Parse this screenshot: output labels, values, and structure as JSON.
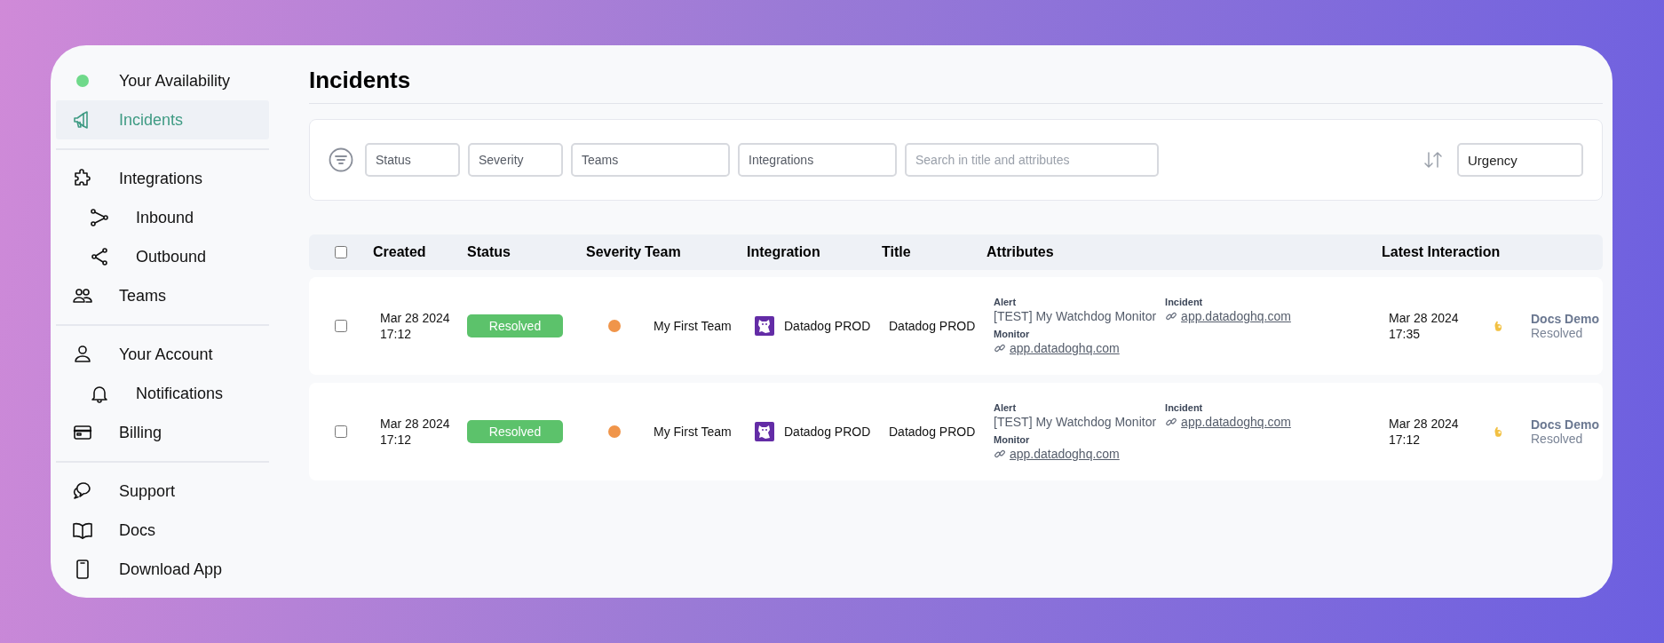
{
  "sidebar": {
    "groups": [
      [
        {
          "label": "Your Availability",
          "kind": "status",
          "color": "#6fd98a",
          "selected": false
        },
        {
          "label": "Incidents",
          "kind": "link",
          "selected": true
        }
      ],
      [
        {
          "label": "Integrations",
          "kind": "link",
          "selected": false,
          "children": [
            {
              "label": "Inbound",
              "kind": "link",
              "selected": false
            },
            {
              "label": "Outbound",
              "kind": "link",
              "selected": false
            }
          ]
        },
        {
          "label": "Teams",
          "kind": "link",
          "selected": false
        }
      ],
      [
        {
          "label": "Your Account",
          "kind": "link",
          "selected": false,
          "children": [
            {
              "label": "Notifications",
              "kind": "link",
              "selected": false
            }
          ]
        },
        {
          "label": "Billing",
          "kind": "link",
          "selected": false
        }
      ],
      [
        {
          "label": "Support",
          "kind": "link",
          "selected": false
        },
        {
          "label": "Docs",
          "kind": "link",
          "selected": false
        },
        {
          "label": "Download App",
          "kind": "link",
          "selected": false
        }
      ]
    ]
  },
  "page": {
    "title": "Incidents"
  },
  "filters": [
    {
      "kind": "select",
      "placeholder": "Status"
    },
    {
      "kind": "select",
      "placeholder": "Severity"
    },
    {
      "kind": "select",
      "placeholder": "Teams"
    },
    {
      "kind": "select",
      "placeholder": "Integrations"
    },
    {
      "kind": "search",
      "placeholder": "Search in title and attributes"
    }
  ],
  "sort": {
    "value": "Urgency"
  },
  "table": {
    "select_all": {
      "checked": false
    },
    "columns": [
      "Created",
      "Status",
      "Severity",
      "Team",
      "Integration",
      "Title",
      "Attributes",
      "Latest Interaction"
    ],
    "rows": [
      {
        "checked": false,
        "created": {
          "date": "Mar 28 2024",
          "time": "17:12"
        },
        "status": {
          "label": "Resolved",
          "kind": "resolved"
        },
        "severity": {
          "color": "#f0954a"
        },
        "team": "My First Team",
        "integration": "Datadog PROD",
        "title": "Datadog PROD",
        "attributes": [
          {
            "label": "Alert",
            "kind": "text",
            "value": "[TEST] My Watchdog Monitor"
          },
          {
            "label": "Incident",
            "kind": "link",
            "value": "app.datadoghq.com"
          },
          {
            "label": "Monitor",
            "kind": "link",
            "value": "app.datadoghq.com"
          }
        ],
        "latest": {
          "date": "Mar 28 2024",
          "time": "17:35",
          "user": "Docs Demo",
          "action": "Resolved"
        }
      },
      {
        "checked": false,
        "created": {
          "date": "Mar 28 2024",
          "time": "17:12"
        },
        "status": {
          "label": "Resolved",
          "kind": "resolved"
        },
        "severity": {
          "color": "#f0954a"
        },
        "team": "My First Team",
        "integration": "Datadog PROD",
        "title": "Datadog PROD",
        "attributes": [
          {
            "label": "Alert",
            "kind": "text",
            "value": "[TEST] My Watchdog Monitor"
          },
          {
            "label": "Incident",
            "kind": "link",
            "value": "app.datadoghq.com"
          },
          {
            "label": "Monitor",
            "kind": "link",
            "value": "app.datadoghq.com"
          }
        ],
        "latest": {
          "date": "Mar 28 2024",
          "time": "17:12",
          "user": "Docs Demo",
          "action": "Resolved"
        }
      }
    ]
  }
}
